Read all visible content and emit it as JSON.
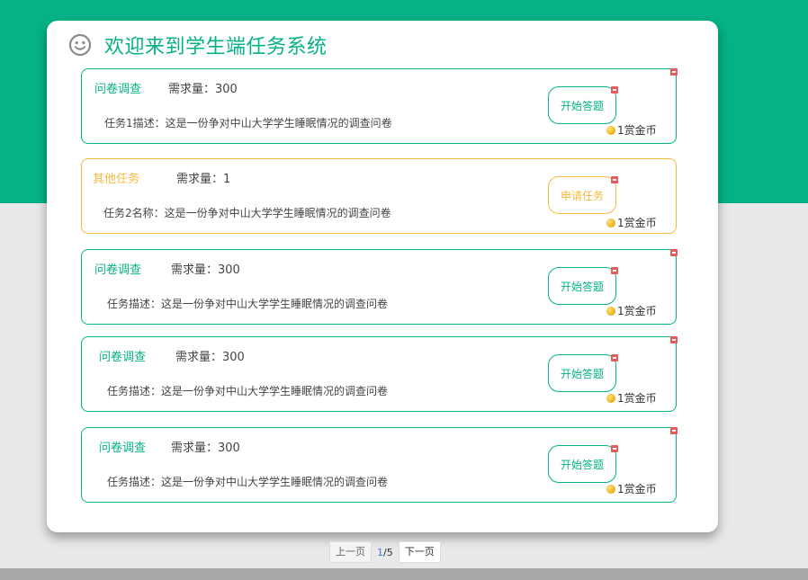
{
  "header": {
    "title": "欢迎来到学生端任务系统",
    "icon": "smile-icon"
  },
  "tasks": [
    {
      "type": "问卷调查",
      "demand": "需求量：300",
      "desc": "任务1描述：这是一份争对中山大学学生睡眠情况的调查问卷",
      "action": "开始答题",
      "reward": "1赏金币",
      "variant": "survey"
    },
    {
      "type": "其他任务",
      "demand": "需求量：1",
      "desc": "任务2名称：这是一份争对中山大学学生睡眠情况的调查问卷",
      "action": "申请任务",
      "reward": "1赏金币",
      "variant": "other"
    },
    {
      "type": "问卷调查",
      "demand": "需求量：300",
      "desc": "任务描述：这是一份争对中山大学学生睡眠情况的调查问卷",
      "action": "开始答题",
      "reward": "1赏金币",
      "variant": "survey"
    },
    {
      "type": "问卷调查",
      "demand": "需求量：300",
      "desc": "任务描述：这是一份争对中山大学学生睡眠情况的调查问卷",
      "action": "开始答题",
      "reward": "1赏金币",
      "variant": "survey"
    },
    {
      "type": "问卷调查",
      "demand": "需求量：300",
      "desc": "任务描述：这是一份争对中山大学学生睡眠情况的调查问卷",
      "action": "开始答题",
      "reward": "1赏金币",
      "variant": "survey"
    }
  ],
  "pagination": {
    "prev": "上一页",
    "current": "1",
    "total": "/5",
    "next": "下一页"
  },
  "colors": {
    "primary": "#05b286",
    "other": "#f7b93e",
    "close": "#e45b5b"
  }
}
